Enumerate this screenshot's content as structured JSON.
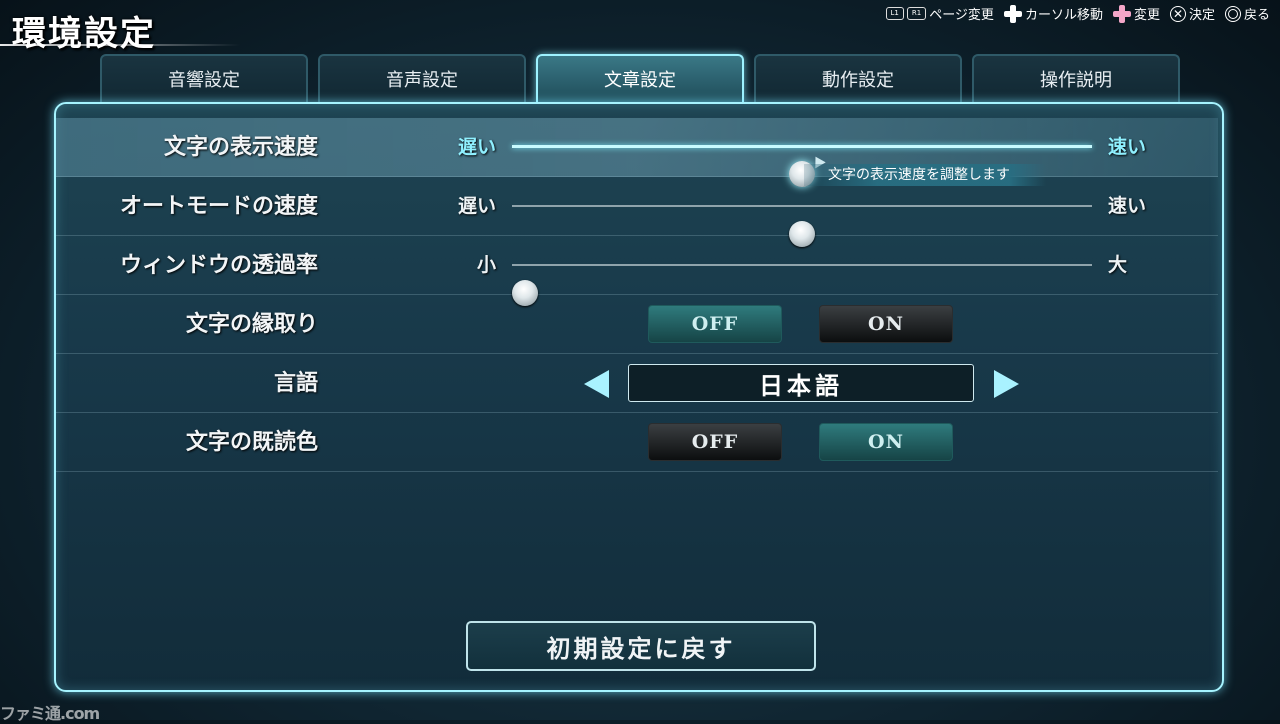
{
  "title": "環境設定",
  "hints": [
    {
      "button": "L1",
      "button2": "R1",
      "label": "ページ変更"
    },
    {
      "icon": "dpad-icon",
      "label": "カーソル移動"
    },
    {
      "icon": "dpad-pink-icon",
      "label": "変更"
    },
    {
      "icon": "cross-button-icon",
      "label": "決定"
    },
    {
      "icon": "circle-button-icon",
      "label": "戻る"
    }
  ],
  "tabs": [
    "音響設定",
    "音声設定",
    "文章設定",
    "動作設定",
    "操作説明"
  ],
  "active_tab": "文章設定",
  "settings": {
    "text_speed": {
      "label": "文字の表示速度",
      "min_label": "遅い",
      "max_label": "速い",
      "value": 0.5,
      "tooltip": "文字の表示速度を調整します"
    },
    "auto_speed": {
      "label": "オートモードの速度",
      "min_label": "遅い",
      "max_label": "速い",
      "value": 0.5
    },
    "window_opacity": {
      "label": "ウィンドウの透過率",
      "min_label": "小",
      "max_label": "大",
      "value": 0.0
    },
    "text_outline": {
      "label": "文字の縁取り",
      "off": "OFF",
      "on": "ON",
      "selected": "OFF"
    },
    "language": {
      "label": "言語",
      "value": "日本語"
    },
    "read_color": {
      "label": "文字の既読色",
      "off": "OFF",
      "on": "ON",
      "selected": "ON"
    }
  },
  "reset_label": "初期設定に戻す",
  "watermark": "ファミ通.com"
}
